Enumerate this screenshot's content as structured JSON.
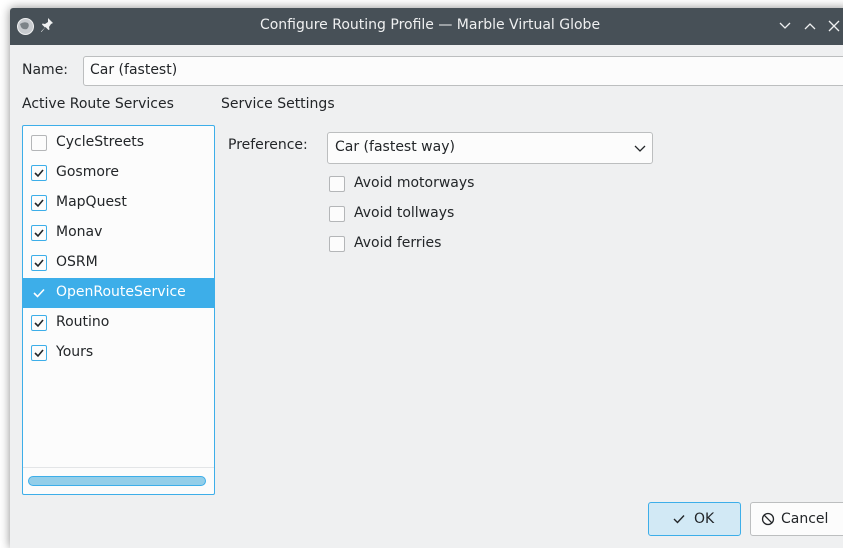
{
  "window": {
    "title": "Configure Routing Profile — Marble Virtual Globe",
    "icons": [
      "app-icon",
      "pin-icon",
      "minimize-icon",
      "maximize-icon",
      "close-icon"
    ]
  },
  "name_field": {
    "label": "Name:",
    "value": "Car (fastest)"
  },
  "services": {
    "heading": "Active Route Services",
    "items": [
      {
        "label": "CycleStreets",
        "checked": false
      },
      {
        "label": "Gosmore",
        "checked": true
      },
      {
        "label": "MapQuest",
        "checked": true
      },
      {
        "label": "Monav",
        "checked": true
      },
      {
        "label": "OSRM",
        "checked": true
      },
      {
        "label": "OpenRouteService",
        "checked": true,
        "selected": true
      },
      {
        "label": "Routino",
        "checked": true
      },
      {
        "label": "Yours",
        "checked": true
      }
    ]
  },
  "settings": {
    "heading": "Service Settings",
    "preference_label": "Preference:",
    "preference_value": "Car (fastest way)",
    "options": [
      {
        "label": "Avoid motorways",
        "checked": false
      },
      {
        "label": "Avoid tollways",
        "checked": false
      },
      {
        "label": "Avoid ferries",
        "checked": false
      }
    ]
  },
  "buttons": {
    "ok": "OK",
    "cancel": "Cancel"
  },
  "colors": {
    "accent": "#3daee9",
    "titlebar": "#475057",
    "window_bg": "#eff0f1",
    "text": "#232629"
  }
}
